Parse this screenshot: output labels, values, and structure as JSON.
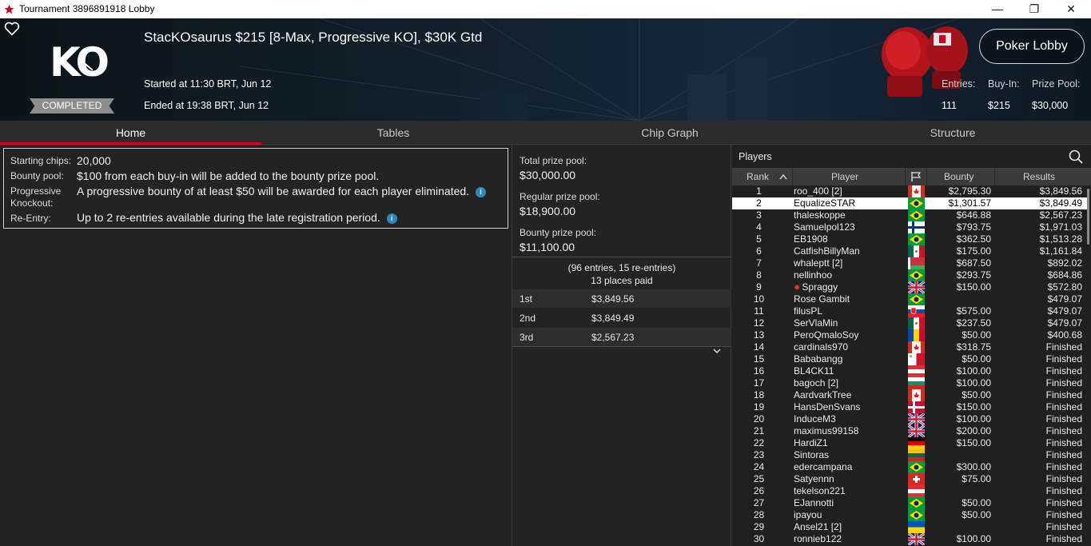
{
  "window": {
    "title": "Tournament 3896891918 Lobby",
    "minimize": "—",
    "maximize": "❐",
    "close": "✕"
  },
  "header": {
    "logo_text": "KO",
    "status": "COMPLETED",
    "name": "StacKOsaurus $215 [8-Max, Progressive KO], $30K Gtd",
    "started": "Started at 11:30 BRT, Jun 12",
    "ended": "Ended at 19:38 BRT, Jun 12",
    "lobby_button": "Poker Lobby",
    "stats": {
      "entries_label": "Entries:",
      "entries_value": "111",
      "buyin_label": "Buy-In:",
      "buyin_value": "$215",
      "prizepool_label": "Prize Pool:",
      "prizepool_value": "$30,000"
    }
  },
  "tabs": [
    {
      "label": "Home",
      "active": true
    },
    {
      "label": "Tables",
      "active": false
    },
    {
      "label": "Chip Graph",
      "active": false
    },
    {
      "label": "Structure",
      "active": false
    }
  ],
  "info": {
    "starting_chips_label": "Starting chips:",
    "starting_chips_value": "20,000",
    "bounty_pool_label": "Bounty pool:",
    "bounty_pool_value": "$100 from each buy-in will be added to the bounty prize pool.",
    "progressive_label_1": "Progressive",
    "progressive_label_2": "Knockout:",
    "progressive_value": "A progressive bounty of at least $50 will be awarded for each player eliminated.",
    "reentry_label": "Re-Entry:",
    "reentry_value": "Up to 2 re-entries available during the late registration period."
  },
  "prize": {
    "total_label": "Total prize pool:",
    "total_value": "$30,000.00",
    "regular_label": "Regular prize pool:",
    "regular_value": "$18,900.00",
    "bounty_label": "Bounty prize pool:",
    "bounty_value": "$11,100.00",
    "entries_summary": "(96 entries, 15 re-entries)",
    "places_paid": "13 places paid",
    "payouts": [
      {
        "place": "1st",
        "amount": "$3,849.56"
      },
      {
        "place": "2nd",
        "amount": "$3,849.49"
      },
      {
        "place": "3rd",
        "amount": "$2,567.23"
      }
    ]
  },
  "players": {
    "title": "Players",
    "columns": {
      "rank": "Rank",
      "player": "Player",
      "bounty": "Bounty",
      "results": "Results"
    },
    "rows": [
      {
        "rank": "1",
        "name": "roo_400 [2]",
        "flag": "ca",
        "bounty": "$2,795.30",
        "result": "$3,849.56"
      },
      {
        "rank": "2",
        "name": "EqualizeSTAR",
        "flag": "br",
        "bounty": "$1,301.57",
        "result": "$3,849.49"
      },
      {
        "rank": "3",
        "name": "thaleskoppe",
        "flag": "br",
        "bounty": "$646.88",
        "result": "$2,567.23"
      },
      {
        "rank": "4",
        "name": "Samuelpol123",
        "flag": "fi",
        "bounty": "$793.75",
        "result": "$1,971.03"
      },
      {
        "rank": "5",
        "name": "EB1908",
        "flag": "br",
        "bounty": "$362.50",
        "result": "$1,513.28"
      },
      {
        "rank": "6",
        "name": "CatfishBillyMan",
        "flag": "mx",
        "bounty": "$175.00",
        "result": "$1,161.84"
      },
      {
        "rank": "7",
        "name": "whaleptt [2]",
        "flag": "by",
        "bounty": "$687.50",
        "result": "$892.02"
      },
      {
        "rank": "8",
        "name": "nellinhoo",
        "flag": "br",
        "bounty": "$293.75",
        "result": "$684.86"
      },
      {
        "rank": "9",
        "name": "Spraggy",
        "flag": "gb",
        "bounty": "$150.00",
        "result": "$572.80",
        "star": "✹"
      },
      {
        "rank": "10",
        "name": "Rose Gambit",
        "flag": "br",
        "bounty": "",
        "result": "$479.07"
      },
      {
        "rank": "11",
        "name": "filusPL",
        "flag": "sk",
        "bounty": "$575.00",
        "result": "$479.07"
      },
      {
        "rank": "12",
        "name": "SerVlaMin",
        "flag": "mx",
        "bounty": "$237.50",
        "result": "$479.07"
      },
      {
        "rank": "13",
        "name": "PeroQmaloSoy",
        "flag": "md",
        "bounty": "$50.00",
        "result": "$400.68"
      },
      {
        "rank": "14",
        "name": "cardinals970",
        "flag": "ca",
        "bounty": "$318.75",
        "result": "Finished"
      },
      {
        "rank": "15",
        "name": "Bababangg",
        "flag": "mt",
        "bounty": "$50.00",
        "result": "Finished"
      },
      {
        "rank": "16",
        "name": "BL4CK11",
        "flag": "at",
        "bounty": "$100.00",
        "result": "Finished"
      },
      {
        "rank": "17",
        "name": "bagoch [2]",
        "flag": "bg",
        "bounty": "$100.00",
        "result": "Finished"
      },
      {
        "rank": "18",
        "name": "AardvarkTree",
        "flag": "ca",
        "bounty": "$50.00",
        "result": "Finished"
      },
      {
        "rank": "19",
        "name": "HansDenSvans",
        "flag": "dk",
        "bounty": "$150.00",
        "result": "Finished"
      },
      {
        "rank": "20",
        "name": "InduceM3",
        "flag": "gb",
        "bounty": "$100.00",
        "result": "Finished"
      },
      {
        "rank": "21",
        "name": "maximus99158",
        "flag": "gb",
        "bounty": "$200.00",
        "result": "Finished"
      },
      {
        "rank": "22",
        "name": "HardiZ1",
        "flag": "de",
        "bounty": "$150.00",
        "result": "Finished"
      },
      {
        "rank": "23",
        "name": "Sintoras",
        "flag": "lt",
        "bounty": "",
        "result": "Finished"
      },
      {
        "rank": "24",
        "name": "edercampana",
        "flag": "br",
        "bounty": "$300.00",
        "result": "Finished"
      },
      {
        "rank": "25",
        "name": "Satyennn",
        "flag": "ch",
        "bounty": "$75.00",
        "result": "Finished"
      },
      {
        "rank": "26",
        "name": "tekelson221",
        "flag": "at",
        "bounty": "",
        "result": "Finished"
      },
      {
        "rank": "27",
        "name": "EJannotti",
        "flag": "br",
        "bounty": "$50.00",
        "result": "Finished"
      },
      {
        "rank": "28",
        "name": "ipayou",
        "flag": "br",
        "bounty": "$50.00",
        "result": "Finished"
      },
      {
        "rank": "29",
        "name": "Ansel21 [2]",
        "flag": "ua",
        "bounty": "",
        "result": "Finished"
      },
      {
        "rank": "30",
        "name": "ronnieb122",
        "flag": "gb",
        "bounty": "$100.00",
        "result": "Finished"
      }
    ]
  },
  "colors": {
    "accent_red": "#d0021b",
    "info_blue": "#2f88b8",
    "background": "#232323"
  }
}
